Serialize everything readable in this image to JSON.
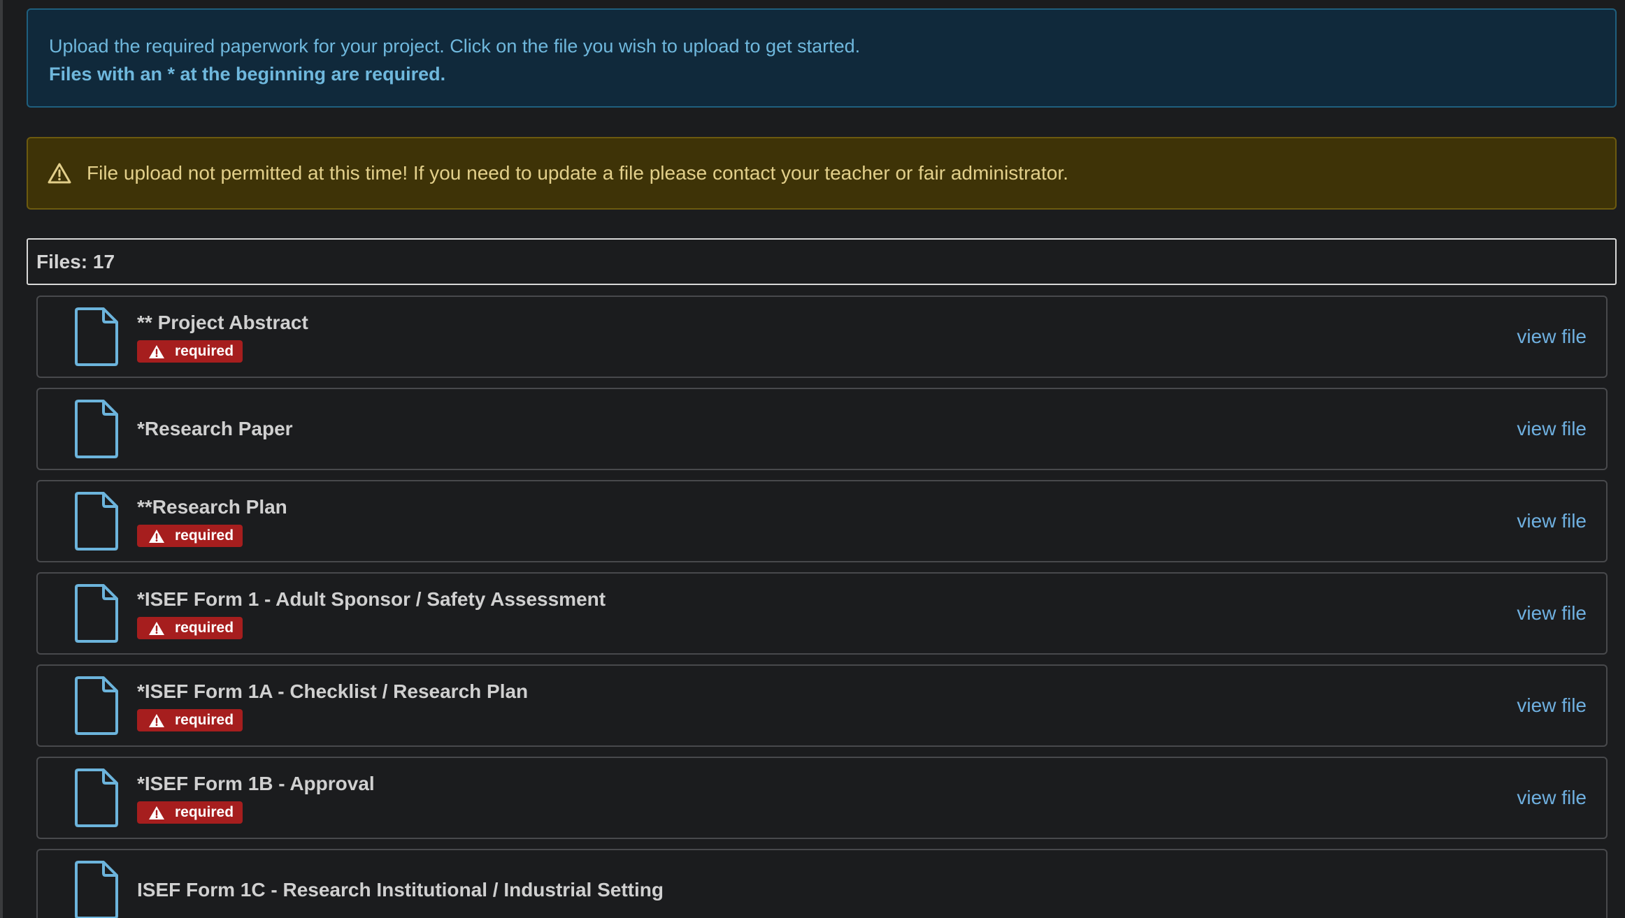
{
  "info": {
    "line1": "Upload the required paperwork for your project. Click on the file you wish to upload to get started.",
    "line2": "Files with an * at the beginning are required."
  },
  "warning": {
    "icon": "warning-triangle-icon",
    "text": "File upload not permitted at this time! If you need to update a file please contact your teacher or fair administrator."
  },
  "files_header": "Files: 17",
  "colors": {
    "info_bg": "#10293b",
    "warning_bg": "#3e3307",
    "badge_red": "#a61e1e",
    "link_blue": "#6fb0e0",
    "file_icon_blue": "#6cb4dc"
  },
  "files": [
    {
      "name": "** Project Abstract",
      "badge": "required",
      "action": "view file"
    },
    {
      "name": "*Research Paper",
      "badge": "",
      "action": "view file"
    },
    {
      "name": "**Research Plan",
      "badge": "required",
      "action": "view file"
    },
    {
      "name": "*ISEF Form 1 - Adult Sponsor / Safety Assessment",
      "badge": "required",
      "action": "view file"
    },
    {
      "name": "*ISEF Form 1A - Checklist / Research Plan",
      "badge": "required",
      "action": "view file"
    },
    {
      "name": "*ISEF Form 1B - Approval",
      "badge": "required",
      "action": "view file"
    },
    {
      "name": "ISEF Form 1C - Research Institutional / Industrial Setting",
      "badge": "",
      "action": ""
    }
  ]
}
